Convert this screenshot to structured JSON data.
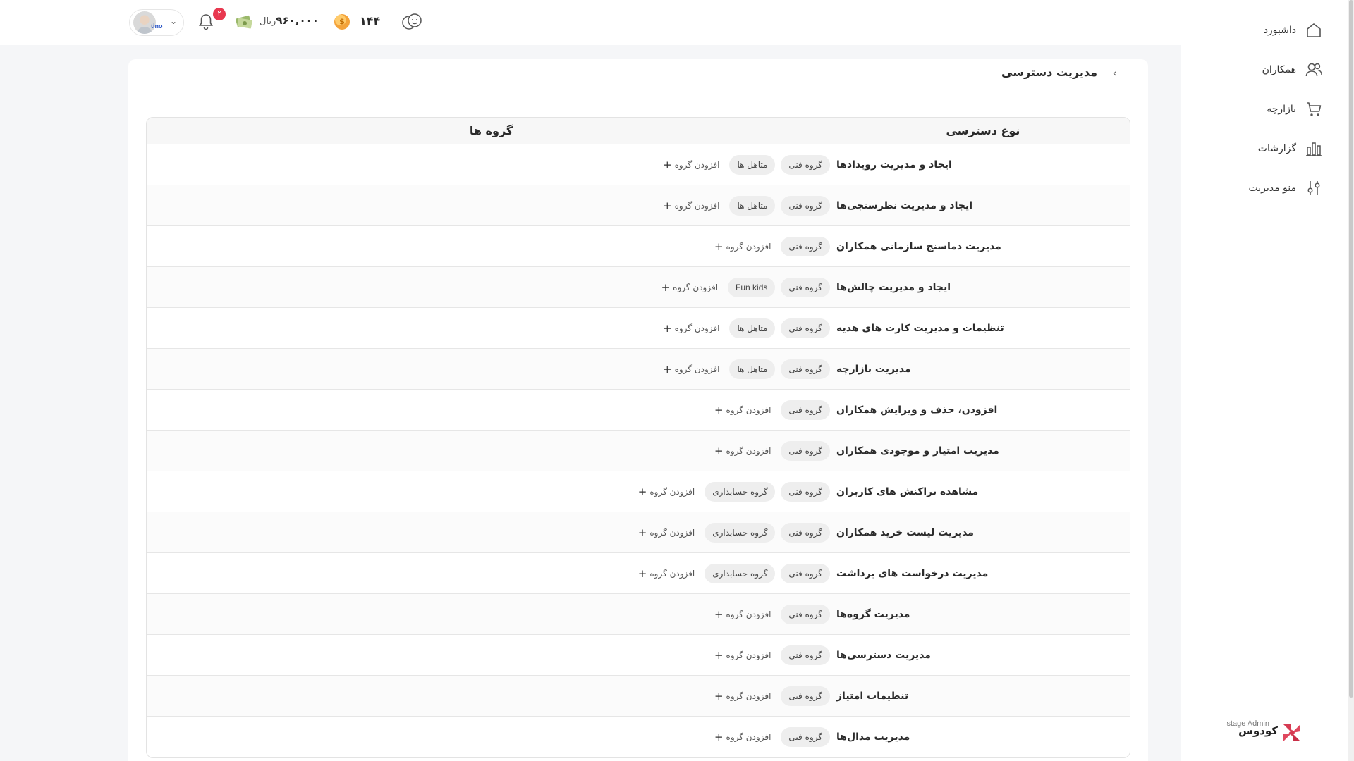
{
  "header": {
    "user_tag": "tino",
    "notification_count": "۲",
    "balance_value": "۹۶۰,۰۰۰",
    "balance_unit": "ریال",
    "coin_count": "۱۴۴"
  },
  "sidebar": {
    "items": [
      {
        "label": "داشبورد",
        "icon": "home-icon"
      },
      {
        "label": "همکاران",
        "icon": "users-icon"
      },
      {
        "label": "بازارچه",
        "icon": "cart-icon"
      },
      {
        "label": "گزارشات",
        "icon": "bar-chart-icon"
      },
      {
        "label": "منو مدیریت",
        "icon": "sliders-icon"
      }
    ],
    "brand_name": "کودوس",
    "brand_stage": "stage Admin"
  },
  "page": {
    "title": "مدیریت دسترسی"
  },
  "table": {
    "headers": {
      "type": "نوع دسترسی",
      "groups": "گروه ها"
    },
    "add_label": "افزودن گروه",
    "rows": [
      {
        "type": "ایجاد و مدیریت رویدادها",
        "groups": [
          "گروه فنی",
          "متاهل ها"
        ]
      },
      {
        "type": "ایجاد و مدیریت نظرسنجی‌ها",
        "groups": [
          "گروه فنی",
          "متاهل ها"
        ]
      },
      {
        "type": "مدیریت دماسنج سازمانی همکاران",
        "groups": [
          "گروه فنی"
        ]
      },
      {
        "type": "ایجاد و مدیریت چالش‌ها",
        "groups": [
          "گروه فنی",
          "Fun kids"
        ]
      },
      {
        "type": "تنظیمات و مدیریت کارت های هدیه",
        "groups": [
          "گروه فنی",
          "متاهل ها"
        ]
      },
      {
        "type": "مدیریت بازارچه",
        "groups": [
          "گروه فنی",
          "متاهل ها"
        ]
      },
      {
        "type": "افزودن، حذف و ویرایش همکاران",
        "groups": [
          "گروه فنی"
        ]
      },
      {
        "type": "مدیریت امتیاز و موجودی همکاران",
        "groups": [
          "گروه فنی"
        ]
      },
      {
        "type": "مشاهده تراکنش های کاربران",
        "groups": [
          "گروه فنی",
          "گروه حسابداری"
        ]
      },
      {
        "type": "مدیریت لیست خرید همکاران",
        "groups": [
          "گروه فنی",
          "گروه حسابداری"
        ]
      },
      {
        "type": "مدیریت درخواست های برداشت",
        "groups": [
          "گروه فنی",
          "گروه حسابداری"
        ]
      },
      {
        "type": "مدیریت گروه‌ها",
        "groups": [
          "گروه فنی"
        ]
      },
      {
        "type": "مدیریت دسترسی‌ها",
        "groups": [
          "گروه فنی"
        ]
      },
      {
        "type": "تنظیمات امتیاز",
        "groups": [
          "گروه فنی"
        ]
      },
      {
        "type": "مدیریت مدال‌ها",
        "groups": [
          "گروه فنی"
        ]
      }
    ]
  }
}
